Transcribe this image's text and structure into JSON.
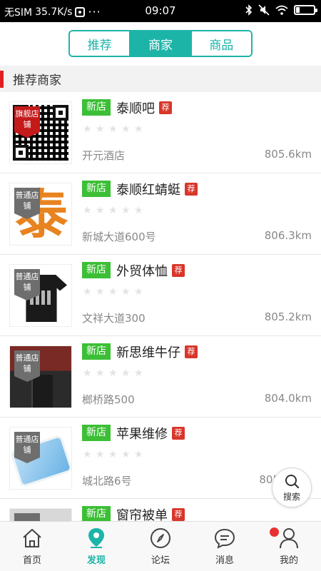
{
  "status_bar": {
    "carrier": "无SIM",
    "speed": "35.7K/s",
    "dots": "···",
    "time": "09:07"
  },
  "tabs": [
    {
      "label": "推荐",
      "active": false
    },
    {
      "label": "商家",
      "active": true
    },
    {
      "label": "商品",
      "active": false
    }
  ],
  "section": {
    "title": "推荐商家",
    "accent": "#e02020"
  },
  "theme": {
    "primary": "#1db4a8",
    "new_badge": "#3cbf36",
    "rec_badge": "#d9362b"
  },
  "merchants": [
    {
      "tag": "旗舰店铺",
      "tag_type": "flagship",
      "badge": "新店",
      "name": "泰顺吧",
      "rec": "荐",
      "rating": 0,
      "address": "开元酒店",
      "distance": "805.6km",
      "thumb": "qr-code"
    },
    {
      "tag": "普通店铺",
      "tag_type": "normal",
      "badge": "新店",
      "name": "泰顺红蜻蜓",
      "rec": "荐",
      "rating": 0,
      "address": "新城大道600号",
      "distance": "806.3km",
      "thumb": "tai-character",
      "thumb_text": "泰"
    },
    {
      "tag": "普通店铺",
      "tag_type": "normal",
      "badge": "新店",
      "name": "外贸体恤",
      "rec": "荐",
      "rating": 0,
      "address": "文祥大道300",
      "distance": "805.2km",
      "thumb": "t-shirt"
    },
    {
      "tag": "普通店铺",
      "tag_type": "normal",
      "badge": "新店",
      "name": "新思维牛仔",
      "rec": "荐",
      "rating": 0,
      "address": "榔桥路500",
      "distance": "804.0km",
      "thumb": "jeans"
    },
    {
      "tag": "普通店铺",
      "tag_type": "normal",
      "badge": "新店",
      "name": "苹果维修",
      "rec": "荐",
      "rating": 0,
      "address": "城北路6号",
      "distance": "805",
      "thumb": "phone"
    },
    {
      "tag": "普通",
      "tag_type": "normal",
      "badge": "新店",
      "name": "窗帘被单",
      "rec": "荐",
      "rating": 0,
      "address": "",
      "distance": "",
      "thumb": "grey"
    }
  ],
  "fab": {
    "label": "搜索",
    "icon": "search-icon"
  },
  "bottom_nav": [
    {
      "label": "首页",
      "icon": "home-icon",
      "active": false
    },
    {
      "label": "发现",
      "icon": "location-icon",
      "active": true
    },
    {
      "label": "论坛",
      "icon": "compass-icon",
      "active": false
    },
    {
      "label": "消息",
      "icon": "message-icon",
      "active": false,
      "has_dot": true
    },
    {
      "label": "我的",
      "icon": "user-icon",
      "active": false
    }
  ]
}
